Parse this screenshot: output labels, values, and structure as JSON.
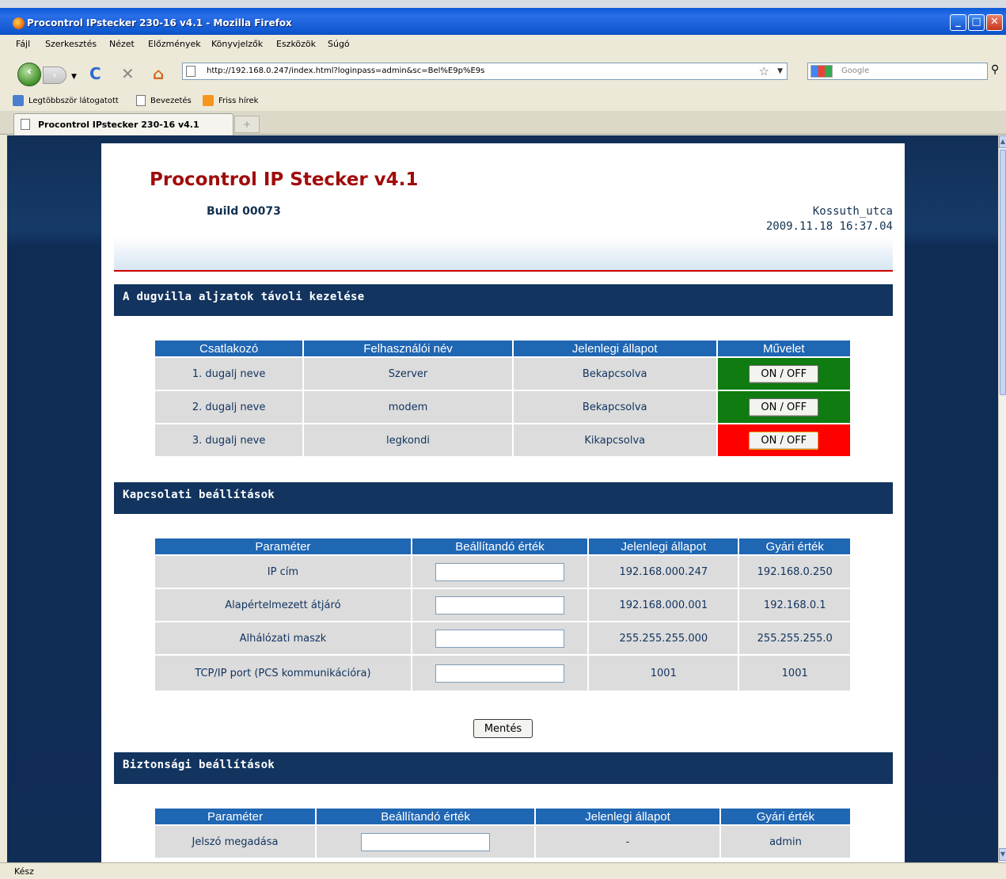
{
  "window": {
    "title": "Procontrol IPstecker 230-16 v4.1 - Mozilla Firefox"
  },
  "menu": [
    "Fájl",
    "Szerkesztés",
    "Nézet",
    "Előzmények",
    "Könyvjelzők",
    "Eszközök",
    "Súgó"
  ],
  "address": {
    "url": "http://192.168.0.247/index.html?loginpass=admin&sc=Bel%E9p%E9s"
  },
  "search": {
    "placeholder": "Google"
  },
  "bookmarks": [
    "Legtöbbször látogatott",
    "Bevezetés",
    "Friss hírek"
  ],
  "tab": {
    "title": "Procontrol IPstecker 230-16 v4.1"
  },
  "status": "Kész",
  "header": {
    "title": "Procontrol IP Stecker v4.1",
    "build": "Build 00073",
    "device": "Kossuth_utca",
    "datetime": "2009.11.18 16:37.04"
  },
  "sockets": {
    "heading": "A dugvilla aljzatok távoli kezelése",
    "columns": [
      "Csatlakozó",
      "Felhasználói név",
      "Jelenlegi állapot",
      "Művelet"
    ],
    "rows": [
      {
        "socket": "1. dugalj neve",
        "name": "Szerver",
        "state": "Bekapcsolva",
        "action": "ON / OFF",
        "color": "#107b10"
      },
      {
        "socket": "2. dugalj neve",
        "name": "modem",
        "state": "Bekapcsolva",
        "action": "ON / OFF",
        "color": "#107b10"
      },
      {
        "socket": "3. dugalj neve",
        "name": "legkondi",
        "state": "Kikapcsolva",
        "action": "ON / OFF",
        "color": "#ff0000"
      }
    ]
  },
  "connection": {
    "heading": "Kapcsolati beállítások",
    "columns": [
      "Paraméter",
      "Beállítandó érték",
      "Jelenlegi állapot",
      "Gyári érték"
    ],
    "rows": [
      {
        "param": "IP cím",
        "value": "",
        "current": "192.168.000.247",
        "factory": "192.168.0.250"
      },
      {
        "param": "Alapértelmezett átjáró",
        "value": "",
        "current": "192.168.000.001",
        "factory": "192.168.0.1"
      },
      {
        "param": "Alhálózati maszk",
        "value": "",
        "current": "255.255.255.000",
        "factory": "255.255.255.0"
      },
      {
        "param": "TCP/IP port (PCS kommunikációra)",
        "value": "",
        "current": "1001",
        "factory": "1001"
      }
    ],
    "save": "Mentés"
  },
  "security": {
    "heading": "Biztonsági beállítások",
    "columns": [
      "Paraméter",
      "Beállítandó érték",
      "Jelenlegi állapot",
      "Gyári érték"
    ],
    "rows": [
      {
        "param": "Jelszó megadása",
        "value": "",
        "current": "-",
        "factory": "admin"
      }
    ]
  }
}
